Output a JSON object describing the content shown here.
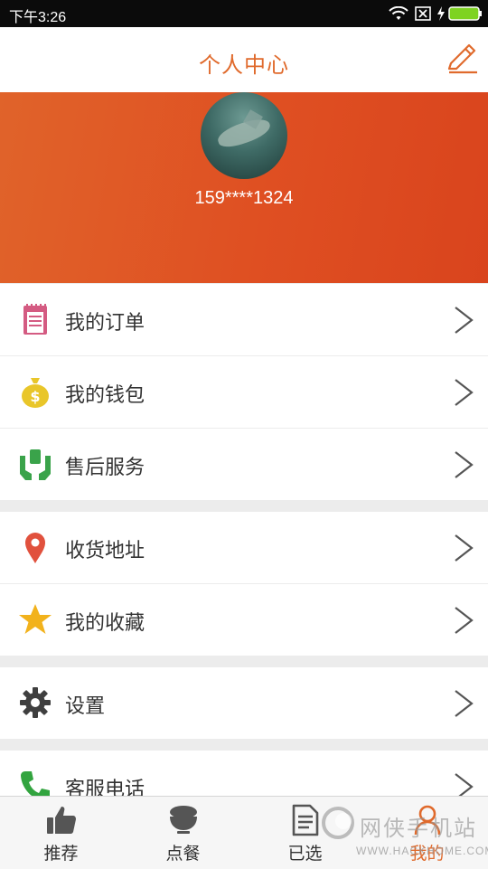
{
  "status_bar": {
    "time": "下午3:26"
  },
  "header": {
    "title": "个人中心"
  },
  "profile": {
    "phone": "159****1324"
  },
  "menu_groups": [
    {
      "items": [
        {
          "label": "我的订单",
          "icon": "order-list-icon"
        },
        {
          "label": "我的钱包",
          "icon": "money-bag-icon"
        },
        {
          "label": "售后服务",
          "icon": "service-hands-icon"
        }
      ]
    },
    {
      "items": [
        {
          "label": "收货地址",
          "icon": "location-pin-icon"
        },
        {
          "label": "我的收藏",
          "icon": "star-icon"
        }
      ]
    },
    {
      "items": [
        {
          "label": "设置",
          "icon": "gear-icon"
        }
      ]
    },
    {
      "items": [
        {
          "label": "客服电话",
          "icon": "phone-icon"
        }
      ]
    }
  ],
  "tabs": [
    {
      "label": "推荐",
      "icon": "thumbs-up-icon"
    },
    {
      "label": "点餐",
      "icon": "bowl-icon"
    },
    {
      "label": "已选",
      "icon": "document-icon"
    },
    {
      "label": "我的",
      "icon": "person-icon",
      "active": true
    }
  ],
  "watermark": {
    "cn": "网侠手机站",
    "en": "WWW.HACKHOME.COM"
  },
  "colors": {
    "accent": "#e06a2c",
    "banner": "#df4f22"
  }
}
